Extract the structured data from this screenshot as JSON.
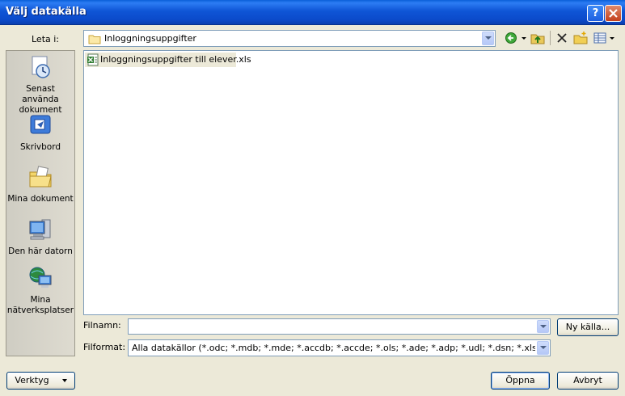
{
  "window": {
    "title": "Välj datakälla"
  },
  "titlebar": {
    "help_label": "?",
    "close_label": "X"
  },
  "lookin": {
    "label": "Leta i:",
    "value": "Inloggningsuppgifter"
  },
  "toolbar": {
    "icons": [
      "back-icon",
      "up-folder-icon",
      "delete-icon",
      "new-folder-icon",
      "views-icon"
    ]
  },
  "places": [
    {
      "label": "Senast använda dokument",
      "icon": "recent-documents-icon"
    },
    {
      "label": "Skrivbord",
      "icon": "desktop-icon"
    },
    {
      "label": "Mina dokument",
      "icon": "my-documents-icon"
    },
    {
      "label": "Den här datorn",
      "icon": "my-computer-icon"
    },
    {
      "label": "Mina nätverksplatser",
      "icon": "network-places-icon"
    }
  ],
  "files": [
    {
      "name": "Inloggningsuppgifter till elever.xls",
      "icon": "excel-file-icon"
    }
  ],
  "filename": {
    "label": "Filnamn:",
    "value": ""
  },
  "filetype": {
    "label": "Filformat:",
    "value": "Alla datakällor (*.odc; *.mdb; *.mde; *.accdb; *.accde; *.ols; *.ade; *.adp; *.udl; *.dsn; *.xlsx; *.xlsm"
  },
  "buttons": {
    "new_source": "Ny källa...",
    "tools": "Verktyg",
    "open": "Öppna",
    "cancel": "Avbryt"
  },
  "colors": {
    "titlebar": "#0a5fd8",
    "dialog_bg": "#ece9d8",
    "field_border": "#7f9db9"
  }
}
